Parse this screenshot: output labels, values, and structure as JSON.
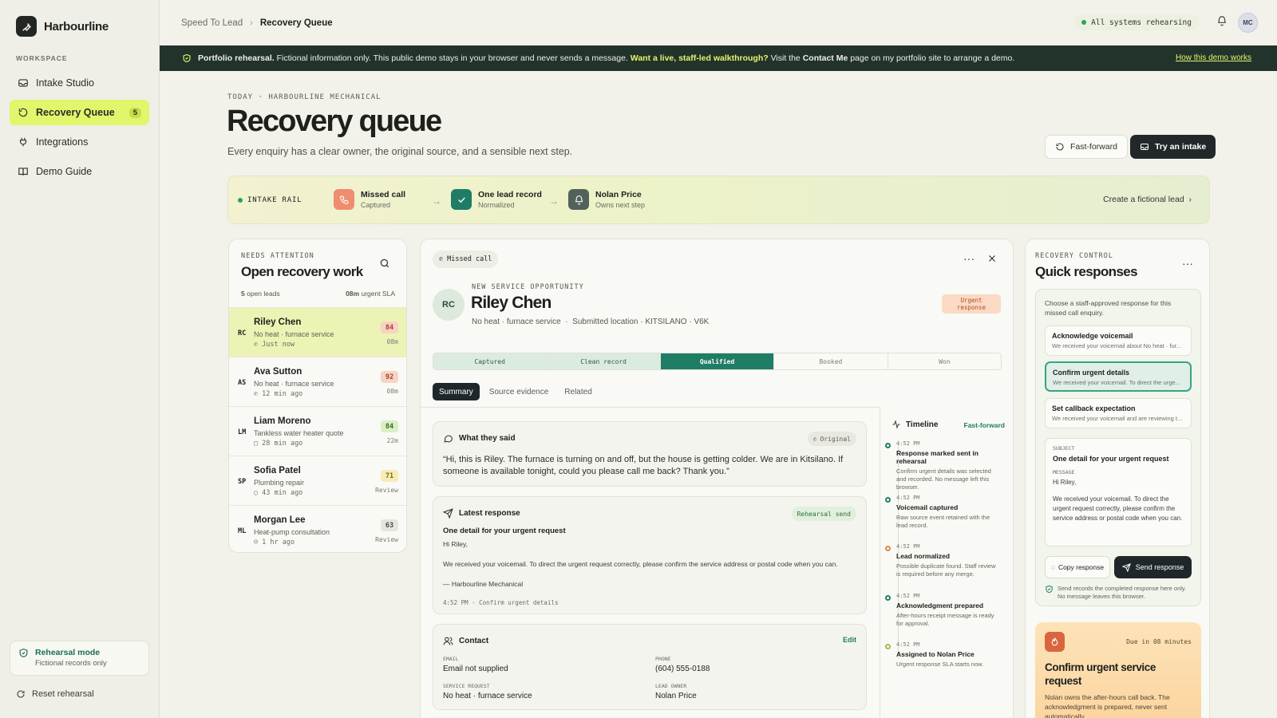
{
  "app": {
    "name": "Harbourline",
    "workspace_label": "WORKSPACE"
  },
  "sidebar": {
    "items": [
      {
        "label": "Intake Studio"
      },
      {
        "label": "Recovery Queue",
        "badge": "5"
      },
      {
        "label": "Integrations"
      },
      {
        "label": "Demo Guide"
      }
    ],
    "rehearsal": {
      "title": "Rehearsal mode",
      "subtitle": "Fictional records only"
    },
    "reset_label": "Reset rehearsal"
  },
  "topbar": {
    "breadcrumb": [
      "Speed To Lead",
      "Recovery Queue"
    ],
    "status": "All systems rehearsing",
    "avatar": "MC"
  },
  "banner": {
    "lead": "Portfolio rehearsal.",
    "text1": "Fictional information only. This public demo stays in your browser and never sends a message.",
    "highlight": "Want a live, staff-led walkthrough?",
    "text2": "Visit the",
    "bold2": "Contact Me",
    "text3": "page on my portfolio site to arrange a demo.",
    "link": "How this demo works"
  },
  "header": {
    "eyebrow": "TODAY · HARBOURLINE MECHANICAL",
    "title": "Recovery queue",
    "subtitle": "Every enquiry has a clear owner, the original source, and a sensible next step.",
    "fast_forward": "Fast-forward",
    "try_intake": "Try an intake"
  },
  "rail": {
    "label": "INTAKE RAIL",
    "steps": [
      {
        "title": "Missed call",
        "sub": "Captured"
      },
      {
        "title": "One lead record",
        "sub": "Normalized"
      },
      {
        "title": "Nolan Price",
        "sub": "Owns next step"
      }
    ],
    "cta": "Create a fictional lead"
  },
  "queue": {
    "eyebrow": "NEEDS ATTENTION",
    "title": "Open recovery work",
    "count": "5",
    "count_label": "open leads",
    "sla": "08m",
    "sla_label": "urgent SLA",
    "leads": [
      {
        "initials": "RC",
        "name": "Riley Chen",
        "desc": "No heat · furnace service",
        "time": "Just now",
        "score": "84",
        "sla": "08m"
      },
      {
        "initials": "AS",
        "name": "Ava Sutton",
        "desc": "No heat · furnace service",
        "time": "12 min ago",
        "score": "92",
        "sla": "08m"
      },
      {
        "initials": "LM",
        "name": "Liam Moreno",
        "desc": "Tankless water heater quote",
        "time": "28 min ago",
        "score": "84",
        "sla": "22m"
      },
      {
        "initials": "SP",
        "name": "Sofia Patel",
        "desc": "Plumbing repair",
        "time": "43 min ago",
        "score": "71",
        "sla": "Review"
      },
      {
        "initials": "ML",
        "name": "Morgan Lee",
        "desc": "Heat-pump consultation",
        "time": "1 hr ago",
        "score": "63",
        "sla": "Review"
      }
    ]
  },
  "detail": {
    "source_chip": "Missed call",
    "eyebrow": "NEW SERVICE OPPORTUNITY",
    "initials": "RC",
    "name": "Riley Chen",
    "sub1": "No heat · furnace service",
    "sub2": "Submitted location · KITSILANO · V6K",
    "urgent_line1": "Urgent",
    "urgent_line2": "response",
    "stages": [
      "Captured",
      "Clean record",
      "Qualified",
      "Booked",
      "Won"
    ],
    "tabs": [
      "Summary",
      "Source evidence",
      "Related"
    ],
    "said": {
      "title": "What they said",
      "tag": "Original",
      "quote": "“Hi, this is Riley. The furnace is turning on and off, but the house is getting colder. We are in Kitsilano. If someone is available tonight, could you please call me back? Thank you.”"
    },
    "latest": {
      "title": "Latest response",
      "tag": "Rehearsal send",
      "subject": "One detail for your urgent request",
      "greeting": "Hi Riley,",
      "body": "We received your voicemail. To direct the urgent request correctly, please confirm the service address or postal code when you can.",
      "sign": "— Harbourline Mechanical",
      "meta": "4:52 PM · Confirm urgent details"
    },
    "contact": {
      "title": "Contact",
      "edit": "Edit",
      "email_label": "EMAIL",
      "email": "Email not supplied",
      "phone_label": "PHONE",
      "phone": "(604) 555-0188",
      "service_label": "SERVICE REQUEST",
      "service": "No heat · furnace service",
      "owner_label": "LEAD OWNER",
      "owner": "Nolan Price"
    },
    "timeline": {
      "title": "Timeline",
      "action": "Fast-forward",
      "items": [
        {
          "time": "4:52 PM",
          "title": "Response marked sent in rehearsal",
          "desc": "Confirm urgent details was selected and recorded. No message left this browser."
        },
        {
          "time": "4:52 PM",
          "title": "Voicemail captured",
          "desc": "Raw source event retained with the lead record."
        },
        {
          "time": "4:52 PM",
          "title": "Lead normalized",
          "desc": "Possible duplicate found. Staff review is required before any merge."
        },
        {
          "time": "4:52 PM",
          "title": "Acknowledgment prepared",
          "desc": "After-hours receipt message is ready for approval."
        },
        {
          "time": "4:52 PM",
          "title": "Assigned to Nolan Price",
          "desc": "Urgent response SLA starts now."
        }
      ]
    }
  },
  "quick": {
    "eyebrow": "RECOVERY CONTROL",
    "title": "Quick responses",
    "intro": "Choose a staff-approved response for this missed call enquiry.",
    "options": [
      {
        "title": "Acknowledge voicemail",
        "sub": "We received your voicemail about No heat · fur..."
      },
      {
        "title": "Confirm urgent details",
        "sub": "We received your voicemail. To direct the urge..."
      },
      {
        "title": "Set callback expectation",
        "sub": "We received your voicemail and are reviewing t..."
      }
    ],
    "subject_label": "SUBJECT",
    "subject": "One detail for your urgent request",
    "message_label": "MESSAGE",
    "msg_greeting": "Hi Riley,",
    "msg_body": "We received your voicemail. To direct the urgent request correctly, please confirm the service address or postal code when you can.",
    "copy": "Copy response",
    "send": "Send response",
    "note": "Send records the completed response here only. No message leaves this browser.",
    "due_label": "Due in 08 minutes",
    "due_title": "Confirm urgent service request",
    "due_desc": "Nolan owns the after-hours call back. The acknowledgment is prepared, never sent automatically."
  }
}
